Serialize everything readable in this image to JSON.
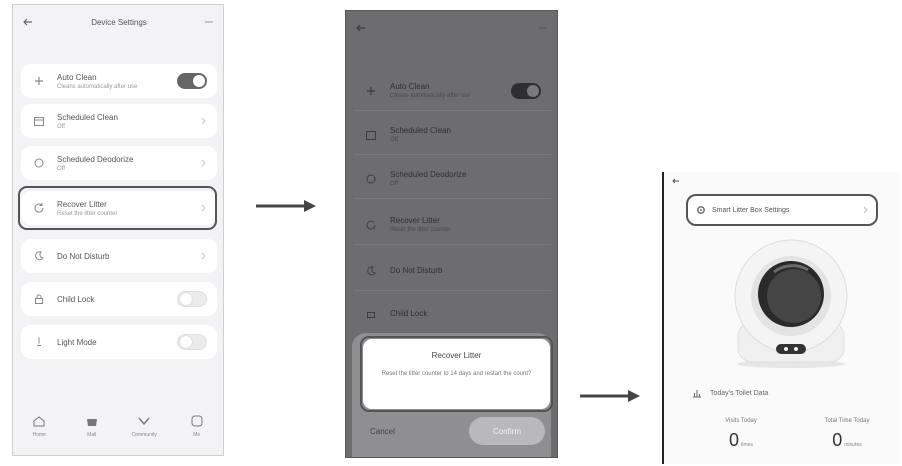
{
  "screen1": {
    "title": "Device Settings",
    "items": [
      {
        "label": "Auto Clean",
        "sub": "Cleans automatically after use",
        "control": "toggle-on"
      },
      {
        "label": "Scheduled Clean",
        "sub": "Off",
        "control": "chevron"
      },
      {
        "label": "Scheduled Deodorize",
        "sub": "Off",
        "control": "chevron"
      },
      {
        "label": "Recover Litter",
        "sub": "Reset the litter counter",
        "control": "chevron"
      },
      {
        "label": "Do Not Disturb",
        "sub": "",
        "control": "chevron"
      },
      {
        "label": "Child Lock",
        "sub": "",
        "control": "toggle-off"
      },
      {
        "label": "Light Mode",
        "sub": "",
        "control": "toggle-off"
      }
    ],
    "tabs": [
      "Home",
      "Mall",
      "Community",
      "Me"
    ]
  },
  "screen2": {
    "items": [
      {
        "label": "Auto Clean",
        "sub": "Cleans automatically after use"
      },
      {
        "label": "Scheduled Clean",
        "sub": "Off"
      },
      {
        "label": "Scheduled Deodorize",
        "sub": "Off"
      },
      {
        "label": "Recover Litter",
        "sub": "Reset the litter counter"
      },
      {
        "label": "Do Not Disturb",
        "sub": ""
      },
      {
        "label": "Child Lock",
        "sub": ""
      }
    ],
    "dialog": {
      "title": "Recover Litter",
      "message": "Reset the litter counter to 14 days and restart the count?",
      "cancel": "Cancel",
      "confirm": "Confirm"
    }
  },
  "screen3": {
    "device_label": "Smart Litter Box Settings",
    "stats_title": "Today's Toilet Data",
    "stats": [
      {
        "label": "Visits Today",
        "value": "0",
        "unit": "times"
      },
      {
        "label": "Total Time Today",
        "value": "0",
        "unit": "minutes"
      }
    ]
  }
}
